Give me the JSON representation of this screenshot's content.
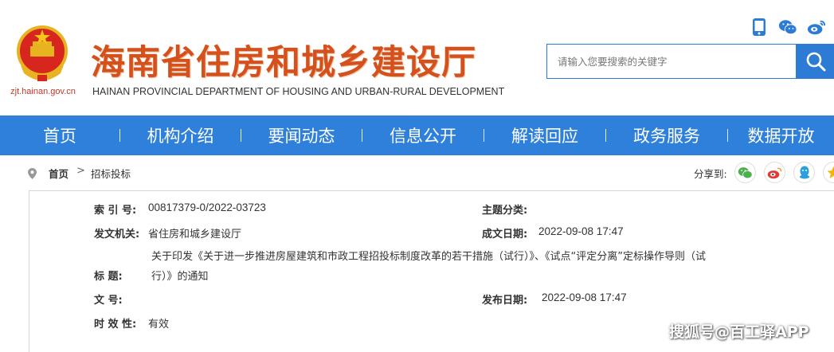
{
  "header": {
    "site_title": "海南省住房和城乡建设厅",
    "site_subtitle": "HAINAN PROVINCIAL DEPARTMENT OF HOUSING AND URBAN-RURAL DEVELOPMENT",
    "domain": "zjt.hainan.gov.cn",
    "search_placeholder": "请输入您要搜索的关键字"
  },
  "top_icons": [
    "mobile-icon",
    "wechat-icon",
    "weibo-icon"
  ],
  "nav": {
    "items": [
      {
        "label": "首页"
      },
      {
        "label": "机构介绍"
      },
      {
        "label": "要闻动态"
      },
      {
        "label": "信息公开"
      },
      {
        "label": "解读回应"
      },
      {
        "label": "政务服务"
      },
      {
        "label": "数据开放"
      }
    ]
  },
  "breadcrumb": {
    "home": "首页",
    "separator": ">",
    "current": "招标投标"
  },
  "share": {
    "label": "分享到:",
    "targets": [
      "wechat",
      "weibo",
      "qq",
      "qzone"
    ]
  },
  "info": {
    "index_label": "索  引 号:",
    "index_value": "00817379-0/2022-03723",
    "topic_label": "主题分类:",
    "topic_value": "",
    "issuer_label": "发文机关:",
    "issuer_value": "省住房和城乡建设厅",
    "created_label": "成文日期:",
    "created_value": "2022-09-08 17:47",
    "title_label": "标       题:",
    "title_line1": "关于印发《关于进一步推进房屋建筑和市政工程招投标制度改革的若干措施（试行）》、《试点“评定分离”定标操作导则（试",
    "title_line2": "行）》的通知",
    "docno_label": "文       号:",
    "docno_value": "",
    "published_label": "发布日期:",
    "published_value": "2022-09-08 17:47",
    "validity_label": "时 效 性:",
    "validity_value": "有效"
  },
  "watermark": "搜狐号@百工驿APP",
  "colors": {
    "nav_bg": "#2f80db",
    "title_orange": "#d4501c",
    "search_blue": "#2c7bd5"
  }
}
